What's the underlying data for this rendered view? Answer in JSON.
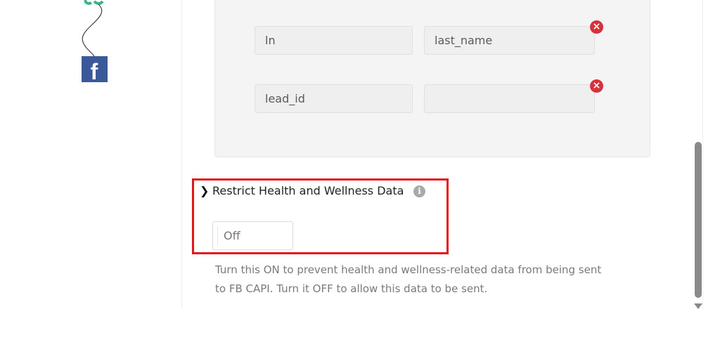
{
  "flow": {
    "facebook_icon_glyph": "f"
  },
  "mappings": [
    {
      "key": "ln",
      "value": "last_name"
    },
    {
      "key": "lead_id",
      "value": ""
    }
  ],
  "remove_glyph": "×",
  "restrict_section": {
    "chevron": "❯",
    "title": "Restrict Health and Wellness Data",
    "info_glyph": "i",
    "toggle_value": "Off",
    "help_text": "Turn this ON to prevent health and wellness-related data from being sent to FB CAPI. Turn it OFF to allow this data to be sent."
  },
  "colors": {
    "highlight": "#e3161b",
    "remove": "#d6323c",
    "facebook": "#3b5998",
    "connector_green": "#3bb58e"
  }
}
